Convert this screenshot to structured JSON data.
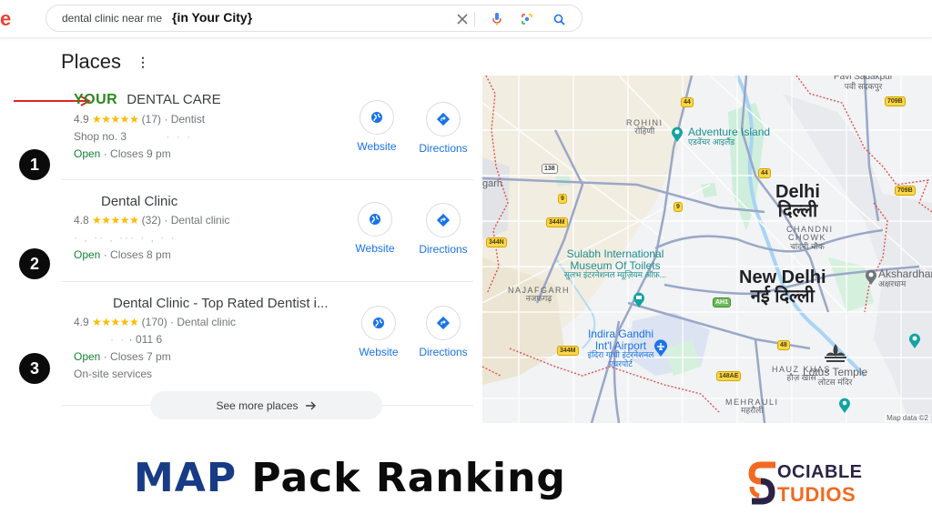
{
  "search": {
    "logo_fragment": "e",
    "query": "dental clinic near me",
    "query_suffix": "{in Your City}",
    "icons": [
      "close-icon",
      "mic-icon",
      "lens-icon",
      "search-icon"
    ]
  },
  "places": {
    "title": "Places",
    "menu_icon": "more-vert-icon",
    "see_more_label": "See more places",
    "see_more_icon": "arrow-right-icon",
    "listings": [
      {
        "rank": "1",
        "highlight": "YOUR",
        "name": "DENTAL CARE",
        "rating": "4.9",
        "stars": "★★★★★",
        "reviews": "(17)",
        "category": "· Dentist",
        "address": "Shop no. 3",
        "address_blur": "· ·  ·",
        "status": "Open",
        "hours": "· Closes 9 pm",
        "extra": "",
        "website_label": "Website",
        "directions_label": "Directions"
      },
      {
        "rank": "2",
        "highlight": "",
        "name": "Dental Clinic",
        "rating": "4.8",
        "stars": "★★★★★",
        "reviews": "(32)",
        "category": "· Dental clinic",
        "address": "",
        "address_blur": "· ,  ·· , ··· · ,           · ·",
        "status": "Open",
        "hours": "· Closes 8 pm",
        "extra": "",
        "website_label": "Website",
        "directions_label": "Directions"
      },
      {
        "rank": "3",
        "highlight": "",
        "name": "Dental Clinic - Top Rated Dentist i...",
        "rating": "4.9",
        "stars": "★★★★★",
        "reviews": "(170)",
        "category": "· Dental clinic",
        "address": "· 011 6",
        "address_blur": "·     ·",
        "status": "Open",
        "hours": "· Closes 7 pm",
        "extra": "On-site services",
        "website_label": "Website",
        "directions_label": "Directions"
      }
    ]
  },
  "map": {
    "credit": "Map data ©2",
    "cities": [
      {
        "en": "Delhi",
        "hi": "दिल्ली"
      },
      {
        "en": "New Delhi",
        "hi": "नई दिल्ली"
      }
    ],
    "areas": [
      {
        "en": "ROHINI",
        "hi": "रोहिणी"
      },
      {
        "en": "NAJAFGARH",
        "hi": "नजफगढ़"
      },
      {
        "en": "CHANDNI CHOWK",
        "hi": "चांदनी चौक"
      },
      {
        "en": "HAUZ KHAS",
        "hi": "हौज़ खास"
      },
      {
        "en": "MEHRAULI",
        "hi": "महरौली"
      },
      {
        "en": "Pavi Sadakpur",
        "hi": "पवी सदकपुर"
      },
      {
        "en": "garh",
        "hi": ""
      }
    ],
    "pois": [
      {
        "en": "Adventure Island",
        "hi": "एडवेंचर आइलैंड"
      },
      {
        "en": "Sulabh International Museum Of Toilets",
        "hi": "सुलभ इंटरनेशनल म्यूज़ियम ऑफ़..."
      },
      {
        "en": "Indira Gandhi Int'l Airport",
        "hi": "इंदिरा गांधी इंटरनेशनल एयरपोर्ट"
      },
      {
        "en": "Akshardham",
        "hi": "अक्षरधाम"
      },
      {
        "en": "Lotus Temple",
        "hi": "लोटस मंदिर"
      }
    ],
    "road_shields": [
      "44",
      "44",
      "709B",
      "709B",
      "138",
      "9",
      "9",
      "344M",
      "344N",
      "344M",
      "AH1",
      "48",
      "148AE"
    ]
  },
  "footer": {
    "headline_accent": "MAP",
    "headline_rest": "Pack Ranking",
    "brand_top": "OCIABLE",
    "brand_bottom": "TUDIOS",
    "colors": {
      "accent_blue": "#183b86",
      "brand_dark": "#2b2346",
      "brand_orange": "#f26a21",
      "open_green": "#188038",
      "star_yellow": "#fbbc04",
      "link_blue": "#1a73e8"
    }
  }
}
